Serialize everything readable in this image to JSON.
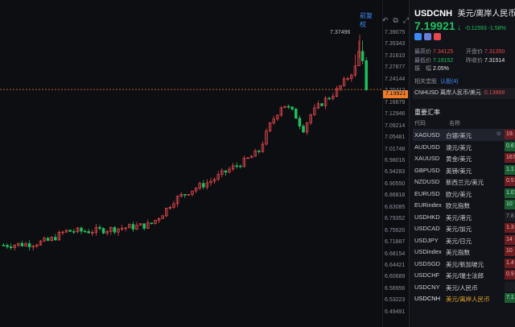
{
  "chart": {
    "price_labels": [
      "7.39075",
      "7.35343",
      "7.31610",
      "7.27877",
      "7.24144",
      "7.20412",
      "7.16679",
      "7.12946",
      "7.09214",
      "7.05481",
      "7.01748",
      "6.98016",
      "6.94283",
      "6.90550",
      "6.86818",
      "6.83085",
      "6.79352",
      "6.75620",
      "6.71887",
      "6.68154",
      "6.64421",
      "6.60689",
      "6.56956",
      "6.53223",
      "6.49491"
    ],
    "peak_label": "7.37496",
    "current_label": "7.19921",
    "tool_link": "前复权",
    "tool_icons": [
      "undo-icon",
      "expand-icon",
      "fullscreen-icon"
    ],
    "colors": {
      "up": "#e5484d",
      "down": "#1dbf5e",
      "price_line": "#f07c28"
    }
  },
  "chart_data": {
    "type": "candlestick",
    "ylim": [
      6.49491,
      7.39075
    ],
    "current_price": 7.19921,
    "peak": 7.37496,
    "candles": []
  },
  "side": {
    "symbol": "USDCNH",
    "name": "美元/离岸人民币",
    "price": "7.19921",
    "arrow": "↓",
    "change": "-0.11593 -1.58%",
    "stats": [
      {
        "k": "最高价",
        "v": "7.34125",
        "c": "red"
      },
      {
        "k": "开盘价",
        "v": "7.31350",
        "c": "red"
      },
      {
        "k": "最低价",
        "v": "7.19152",
        "c": "green"
      },
      {
        "k": "昨收价",
        "v": "7.31514",
        "c": "white"
      },
      {
        "k": "振　幅",
        "v": "2.05%",
        "c": "white"
      }
    ],
    "related_label": "相关堂股",
    "related_value": "认股(4)",
    "inverse": {
      "symbol": "CNHUSD",
      "name": "离岸人民币/美元",
      "price": "0.13888"
    },
    "section_title": "重要汇率",
    "headers": [
      "代码",
      "名称"
    ],
    "rows": [
      {
        "code": "XAGUSD",
        "name": "白银/美元",
        "val": "19.",
        "tone": "neg",
        "selected": true
      },
      {
        "code": "AUDUSD",
        "name": "澳元/美元",
        "val": "0.6",
        "tone": "pos"
      },
      {
        "code": "XAUUSD",
        "name": "黄金/美元",
        "val": "1671",
        "tone": "neg"
      },
      {
        "code": "GBPUSD",
        "name": "英镑/美元",
        "val": "1.1",
        "tone": "pos"
      },
      {
        "code": "NZDUSD",
        "name": "新西兰元/美元",
        "val": "0.5",
        "tone": "neg"
      },
      {
        "code": "EURUSD",
        "name": "欧元/美元",
        "val": "1.0",
        "tone": "pos"
      },
      {
        "code": "EURindex",
        "name": "欧元指数",
        "val": "10",
        "tone": "pos"
      },
      {
        "code": "USDHKD",
        "name": "美元/港元",
        "val": "7.8",
        "tone": "neu"
      },
      {
        "code": "USDCAD",
        "name": "美元/加元",
        "val": "1.3",
        "tone": "neg"
      },
      {
        "code": "USDJPY",
        "name": "美元/日元",
        "val": "14",
        "tone": "neg"
      },
      {
        "code": "USDindex",
        "name": "美元指数",
        "val": "10",
        "tone": "neg"
      },
      {
        "code": "USDSGD",
        "name": "美元/新加坡元",
        "val": "1.4",
        "tone": "neg"
      },
      {
        "code": "USDCHF",
        "name": "美元/瑞士法郎",
        "val": "0.9",
        "tone": "neg"
      },
      {
        "code": "USDCNY",
        "name": "美元/人民币",
        "val": "",
        "tone": "neu"
      },
      {
        "code": "USDCNH",
        "name": "美元/离岸人民币",
        "val": "7.1",
        "tone": "pos",
        "highlight": true
      }
    ]
  }
}
